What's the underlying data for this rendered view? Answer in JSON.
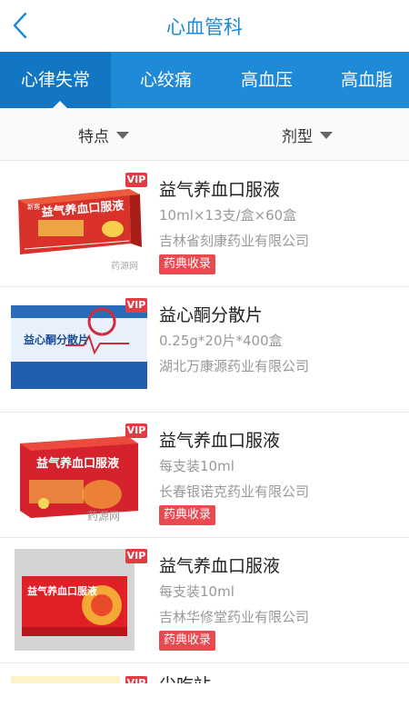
{
  "header": {
    "title": "心血管科",
    "back_icon": "chevron-left-icon"
  },
  "tabs": [
    {
      "label": "心律失常",
      "active": true
    },
    {
      "label": "心绞痛",
      "active": false
    },
    {
      "label": "高血压",
      "active": false
    },
    {
      "label": "高血脂",
      "active": false
    }
  ],
  "filters": {
    "feature": "特点",
    "dosage_form": "剂型"
  },
  "products": [
    {
      "name": "益气养血口服液",
      "spec": "10ml×13支/盒×60盒",
      "maker": "吉林省刻康药业有限公司",
      "badge": "药典收录",
      "vip": "VIP",
      "box_text": "益气养血口服液",
      "box_brand": "新赛",
      "watermark": "药源网"
    },
    {
      "name": "益心酮分散片",
      "spec": "0.25g*20片*400盒",
      "maker": "湖北万康源药业有限公司",
      "vip": "VIP",
      "box_text": "益心酮分散片"
    },
    {
      "name": "益气养血口服液",
      "spec": "每支装10ml",
      "maker": "长春银诺克药业有限公司",
      "badge": "药典收录",
      "vip": "VIP",
      "box_text": "益气养血口服液",
      "watermark": "药源网"
    },
    {
      "name": "益气养血口服液",
      "spec": "每支装10ml",
      "maker": "吉林华修堂药业有限公司",
      "badge": "药典收录",
      "vip": "VIP",
      "box_text": "益气养血口服液"
    }
  ],
  "partial_item": {
    "name": "尖吃站",
    "vip": "VIP"
  },
  "colors": {
    "primary": "#1f8ad8",
    "active_tab": "#1376c2",
    "badge": "#e84a50",
    "vip": "#e23b43"
  }
}
